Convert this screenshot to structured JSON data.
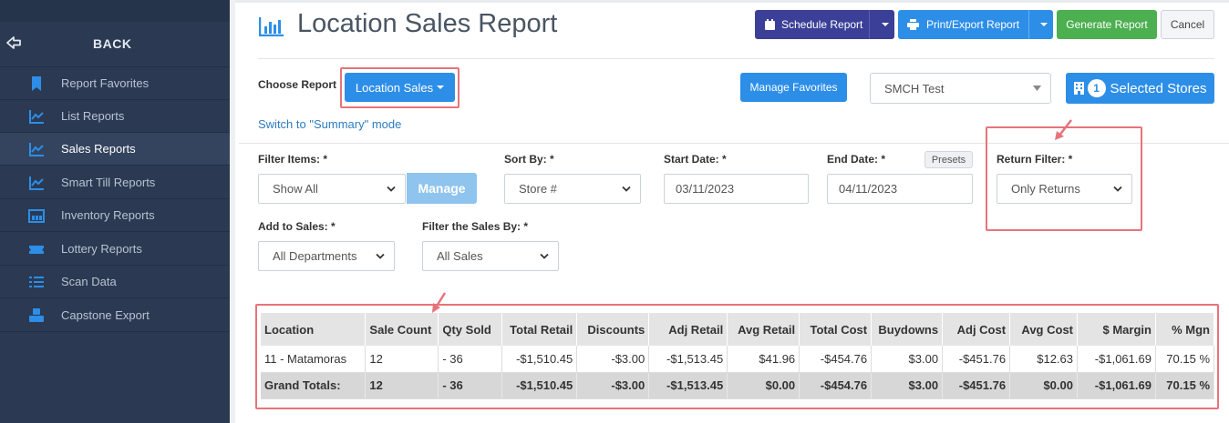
{
  "sidebar": {
    "back_label": "BACK",
    "items": [
      {
        "label": "Report Favorites",
        "icon": "bookmark-icon",
        "active": false
      },
      {
        "label": "List Reports",
        "icon": "line-chart-icon",
        "active": false
      },
      {
        "label": "Sales Reports",
        "icon": "line-chart-icon",
        "active": true
      },
      {
        "label": "Smart Till Reports",
        "icon": "line-chart-icon",
        "active": false
      },
      {
        "label": "Inventory Reports",
        "icon": "warehouse-icon",
        "active": false
      },
      {
        "label": "Lottery Reports",
        "icon": "ticket-icon",
        "active": false
      },
      {
        "label": "Scan Data",
        "icon": "list-icon",
        "active": false
      },
      {
        "label": "Capstone Export",
        "icon": "cubes-icon",
        "active": false
      }
    ]
  },
  "header": {
    "title": "Location Sales Report",
    "schedule_label": "Schedule Report",
    "print_label": "Print/Export Report",
    "generate_label": "Generate Report",
    "cancel_label": "Cancel"
  },
  "choose": {
    "label": "Choose Report",
    "report_button": "Location Sales",
    "switch_link": "Switch to \"Summary\" mode",
    "manage_favorites": "Manage Favorites",
    "store_select": "SMCH Test",
    "selected_count": "1",
    "selected_label": "Selected Stores"
  },
  "filters": {
    "filter_items_label": "Filter Items: *",
    "filter_items_value": "Show All",
    "manage_label": "Manage",
    "sort_by_label": "Sort By: *",
    "sort_by_value": "Store #",
    "start_date_label": "Start Date: *",
    "start_date_value": "03/11/2023",
    "end_date_label": "End Date: *",
    "presets_label": "Presets",
    "end_date_value": "04/11/2023",
    "return_filter_label": "Return Filter: *",
    "return_filter_value": "Only Returns",
    "add_to_sales_label": "Add to Sales: *",
    "add_to_sales_value": "All Departments",
    "filter_sales_label": "Filter the Sales By: *",
    "filter_sales_value": "All Sales"
  },
  "table": {
    "headers": [
      "Location",
      "Sale Count",
      "Qty Sold",
      "Total Retail",
      "Discounts",
      "Adj Retail",
      "Avg Retail",
      "Total Cost",
      "Buydowns",
      "Adj Cost",
      "Avg Cost",
      "$ Margin",
      "% Mgn"
    ],
    "rows": [
      [
        "11 - Matamoras",
        "12",
        "- 36",
        "-$1,510.45",
        "-$3.00",
        "-$1,513.45",
        "$41.96",
        "-$454.76",
        "$3.00",
        "-$451.76",
        "$12.63",
        "-$1,061.69",
        "70.15 %"
      ]
    ],
    "totals": [
      "Grand Totals:",
      "12",
      "- 36",
      "-$1,510.45",
      "-$3.00",
      "-$1,513.45",
      "$0.00",
      "-$454.76",
      "$3.00",
      "-$451.76",
      "$0.00",
      "-$1,061.69",
      "70.15 %"
    ]
  },
  "colors": {
    "sidebar_bg": "#2b3a52",
    "schedule_btn": "#3b3f98",
    "primary_btn": "#2d8ee8",
    "generate_btn": "#4caf50",
    "highlight_red": "#e8737a"
  }
}
